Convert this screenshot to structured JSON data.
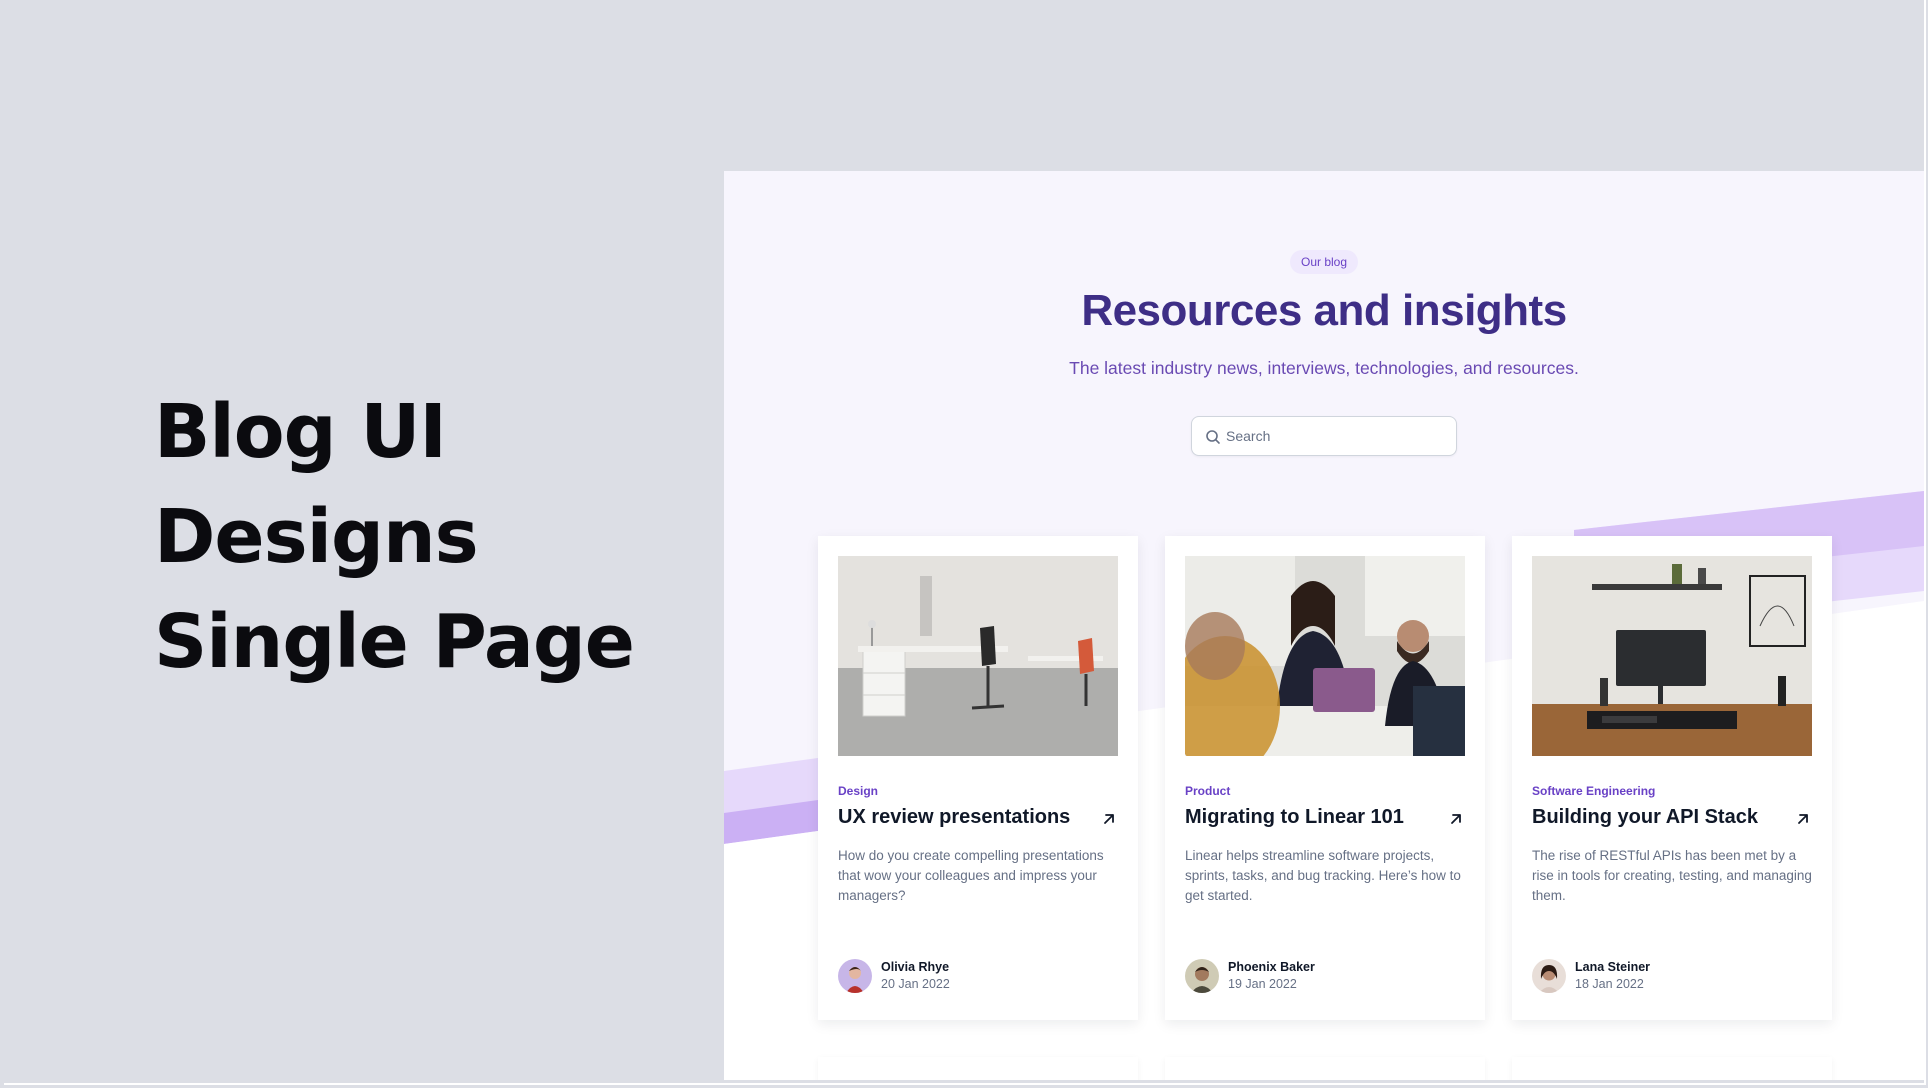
{
  "headline": {
    "line1": "Blog UI",
    "line2": "Designs",
    "line3": "Single Page"
  },
  "blog": {
    "badge": "Our blog",
    "title": "Resources and insights",
    "subtitle": "The latest industry news, interviews, technologies, and resources.",
    "search": {
      "placeholder": "Search",
      "icon": "search-icon"
    }
  },
  "posts": [
    {
      "category": "Design",
      "title": "UX review presentations",
      "excerpt": "How do you create compelling presentations that wow your colleagues and impress your managers?",
      "author": "Olivia Rhye",
      "date": "20 Jan 2022",
      "icon": "arrow-up-right-icon"
    },
    {
      "category": "Product",
      "title": "Migrating to Linear 101",
      "excerpt": "Linear helps streamline software projects, sprints, tasks, and bug tracking. Here’s how to get started.",
      "author": "Phoenix Baker",
      "date": "19 Jan 2022",
      "icon": "arrow-up-right-icon"
    },
    {
      "category": "Software Engineering",
      "title": "Building your API Stack",
      "excerpt": "The rise of RESTful APIs has been met by a rise in tools for creating, testing, and managing them.",
      "author": "Lana Steiner",
      "date": "18 Jan 2022",
      "icon": "arrow-up-right-icon"
    }
  ],
  "colors": {
    "accent": "#6941c6",
    "title": "#3e2e86",
    "stripe_light": "#e6d9fb",
    "stripe_mid": "#d8c2f7",
    "stripe_dark": "#cbb0f4"
  }
}
